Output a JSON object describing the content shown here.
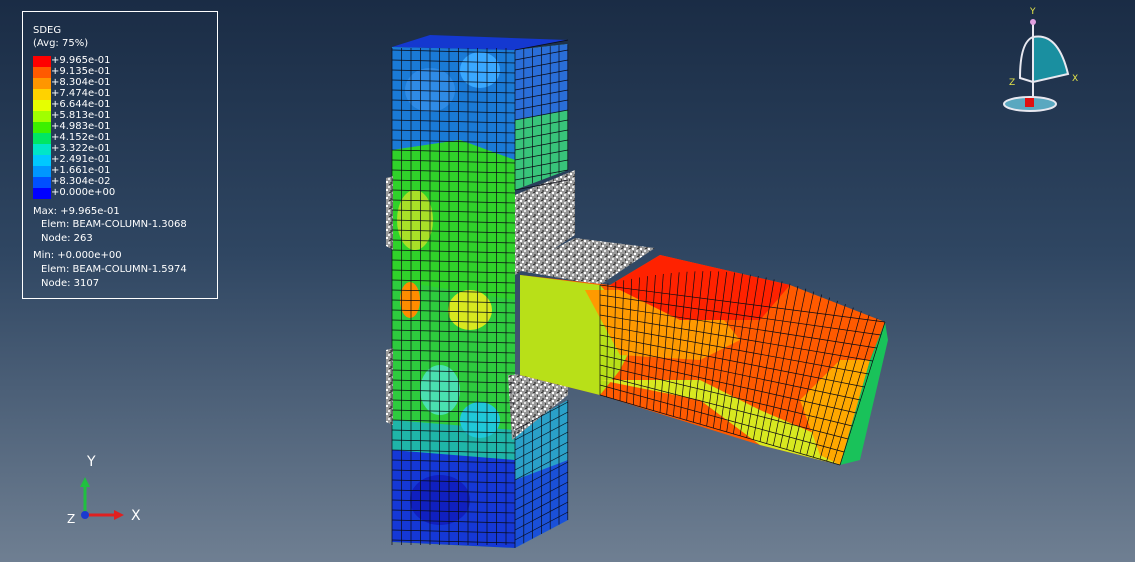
{
  "legend": {
    "variable": "SDEG",
    "averaging": "(Avg: 75%)",
    "levels": [
      {
        "label": "+9.965e-01",
        "color": "#ff0000"
      },
      {
        "label": "+9.135e-01",
        "color": "#ff5a00"
      },
      {
        "label": "+8.304e-01",
        "color": "#ff9600"
      },
      {
        "label": "+7.474e-01",
        "color": "#ffd200"
      },
      {
        "label": "+6.644e-01",
        "color": "#e6ff00"
      },
      {
        "label": "+5.813e-01",
        "color": "#a0ff00"
      },
      {
        "label": "+4.983e-01",
        "color": "#3cf000"
      },
      {
        "label": "+4.152e-01",
        "color": "#00e664"
      },
      {
        "label": "+3.322e-01",
        "color": "#00e6c8"
      },
      {
        "label": "+2.491e-01",
        "color": "#00c8ff"
      },
      {
        "label": "+1.661e-01",
        "color": "#0096ff"
      },
      {
        "label": "+8.304e-02",
        "color": "#0050ff"
      },
      {
        "label": "+0.000e+00",
        "color": "#0000ff"
      }
    ],
    "max_value": "Max: +9.965e-01",
    "max_elem": "Elem: BEAM-COLUMN-1.3068",
    "max_node": "Node: 263",
    "min_value": "Min: +0.000e+00",
    "min_elem": "Elem: BEAM-COLUMN-1.5974",
    "min_node": "Node: 3107"
  },
  "triad": {
    "y": "Y",
    "x": "X",
    "z": "Z"
  },
  "view_cube": {
    "y": "Y",
    "x": "X",
    "z": "Z"
  },
  "colors": {
    "mesh_line": "#0a0a14",
    "plate": "#b4b4b4",
    "bg_top": "#1a2c45",
    "bg_bottom": "#6f7f92"
  }
}
